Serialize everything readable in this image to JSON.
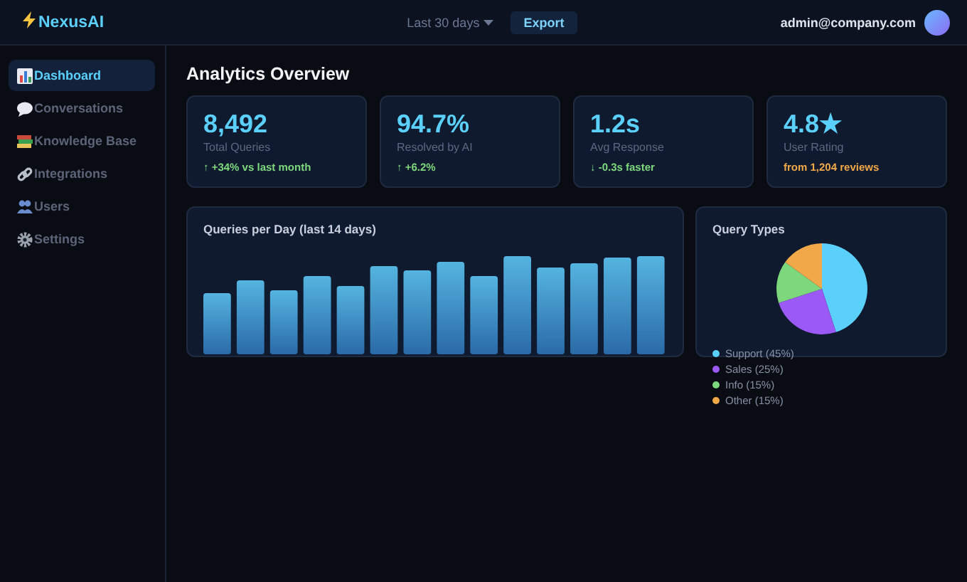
{
  "header": {
    "brand": "NexusAI",
    "range": "Last 30 days",
    "export": "Export",
    "user": "admin@company.com"
  },
  "sidebar": {
    "items": [
      {
        "label": "Dashboard",
        "selected": true
      },
      {
        "label": "Conversations",
        "selected": false
      },
      {
        "label": "Knowledge Base",
        "selected": false
      },
      {
        "label": "Integrations",
        "selected": false
      },
      {
        "label": "Users",
        "selected": false
      },
      {
        "label": "Settings",
        "selected": false
      }
    ]
  },
  "page_title": "Analytics Overview",
  "stats": [
    {
      "value": "8,492",
      "label": "Total Queries",
      "note": "↑ +34% vs last month",
      "kind": "change"
    },
    {
      "value": "94.7%",
      "label": "Resolved by AI",
      "note": "↑ +6.2%",
      "kind": "change"
    },
    {
      "value": "1.2s",
      "label": "Avg Response",
      "note": "↓ -0.3s faster",
      "kind": "change"
    },
    {
      "value": "4.8★",
      "label": "User Rating",
      "note": "from 1,204 reviews",
      "kind": "info"
    }
  ],
  "bar_panel": {
    "title": "Queries per Day (last 14 days)"
  },
  "pie_panel": {
    "title": "Query Types",
    "chart_data": {
      "type": "pie",
      "categories": [
        "Support (45%)",
        "Sales (25%)",
        "Info (15%)",
        "Other (15%)"
      ],
      "values": [
        45,
        25,
        15,
        15
      ],
      "colors": [
        "#5bd0fb",
        "#9b59f5",
        "#7dd87d",
        "#f0a848"
      ]
    }
  }
}
